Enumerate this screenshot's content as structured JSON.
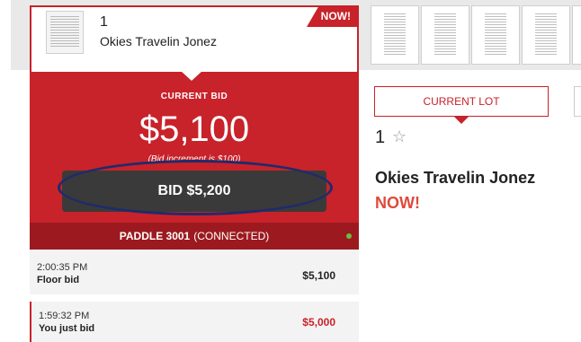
{
  "strip": {
    "active_lot": {
      "number": "1",
      "title": "Okies Travelin Jonez",
      "badge": "NOW!"
    },
    "thumbnail_icon": "document-thumbnail-icon",
    "thumbnail_count": 5
  },
  "bid_panel": {
    "current_bid_label": "CURRENT BID",
    "current_bid_amount": "$5,100",
    "increment_note": "(Bid increment is $100)",
    "bid_button_label": "BID $5,200"
  },
  "paddle": {
    "label": "PADDLE 3001",
    "status": "(CONNECTED)",
    "status_color": "#6abf3c"
  },
  "history": [
    {
      "time": "2:00:35 PM",
      "desc": "Floor bid",
      "amount": "$5,100"
    },
    {
      "time": "1:59:32 PM",
      "desc": "You just bid",
      "amount": "$5,000"
    }
  ],
  "current_lot": {
    "tab_label": "CURRENT LOT",
    "lot_number": "1",
    "star_glyph": "☆",
    "title": "Okies Travelin Jonez",
    "status": "NOW!"
  },
  "colors": {
    "accent_red": "#c8222a",
    "dark_red": "#9c1a1f",
    "button_dark": "#3a3a3a",
    "annotation_ellipse": "#1f2b6b",
    "status_red": "#e0493b"
  }
}
